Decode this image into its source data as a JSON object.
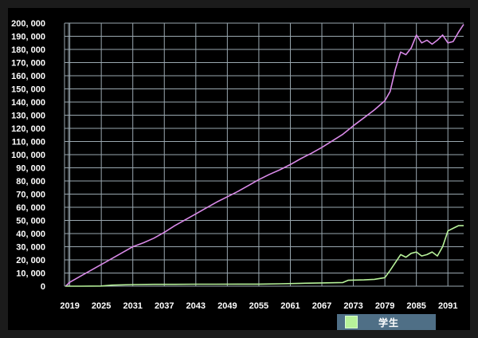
{
  "chart_data": {
    "type": "line",
    "xlabel": "",
    "ylabel": "",
    "xlim": [
      2018,
      2094
    ],
    "ylim": [
      0,
      200000
    ],
    "grid": true,
    "x_ticks": [
      2019,
      2025,
      2031,
      2037,
      2043,
      2049,
      2055,
      2061,
      2067,
      2073,
      2079,
      2085,
      2091
    ],
    "y_ticks": [
      0,
      10000,
      20000,
      30000,
      40000,
      50000,
      60000,
      70000,
      80000,
      90000,
      100000,
      110000,
      120000,
      130000,
      140000,
      150000,
      160000,
      170000,
      180000,
      190000,
      200000
    ],
    "y_tick_labels": [
      "0",
      "10, 000",
      "20, 000",
      "30, 000",
      "40, 000",
      "50, 000",
      "60, 000",
      "70, 000",
      "80, 000",
      "90, 000",
      "100, 000",
      "110, 000",
      "120, 000",
      "130, 000",
      "140, 000",
      "150, 000",
      "160, 000",
      "170, 000",
      "180, 000",
      "190, 000",
      "200, 000"
    ],
    "legend_position": "bottom-right",
    "series": [
      {
        "color": "#d98ae8",
        "x": [
          2018.2,
          2019,
          2021,
          2023,
          2025,
          2027,
          2029,
          2031,
          2033,
          2035,
          2037,
          2039,
          2041,
          2043,
          2045,
          2047,
          2049,
          2051,
          2053,
          2055,
          2057,
          2059,
          2061,
          2063,
          2065,
          2067,
          2069,
          2071,
          2073,
          2075,
          2077,
          2079,
          2080,
          2081,
          2082,
          2083,
          2084,
          2085,
          2086,
          2087,
          2088,
          2089,
          2090,
          2091,
          2092,
          2093,
          2094
        ],
        "values": [
          0,
          3000,
          7500,
          12000,
          16500,
          21000,
          25500,
          30000,
          33000,
          36500,
          41000,
          46000,
          50500,
          55000,
          59500,
          64000,
          68000,
          72000,
          76500,
          81000,
          85000,
          88500,
          92500,
          97000,
          101000,
          105500,
          110500,
          115500,
          122000,
          128000,
          134000,
          141000,
          148000,
          165000,
          178000,
          176000,
          181000,
          191000,
          185000,
          187000,
          184000,
          187000,
          191000,
          185000,
          186000,
          193000,
          199000
        ]
      },
      {
        "name": "学生",
        "color": "#b7f29a",
        "x": [
          2018.2,
          2021,
          2025,
          2027,
          2031,
          2035,
          2039,
          2043,
          2047,
          2051,
          2055,
          2059,
          2063,
          2067,
          2071,
          2072,
          2075,
          2077,
          2079,
          2080,
          2081,
          2082,
          2083,
          2084,
          2085,
          2086,
          2087,
          2088,
          2089,
          2090,
          2091,
          2092,
          2093,
          2094
        ],
        "values": [
          0,
          0,
          100,
          800,
          1200,
          1400,
          1400,
          1500,
          1500,
          1600,
          1600,
          1800,
          2200,
          2500,
          2800,
          4500,
          4800,
          5200,
          6500,
          12000,
          18000,
          24000,
          22000,
          25000,
          26000,
          23000,
          24000,
          26000,
          23000,
          30000,
          42000,
          44000,
          46000,
          46000
        ]
      }
    ]
  }
}
